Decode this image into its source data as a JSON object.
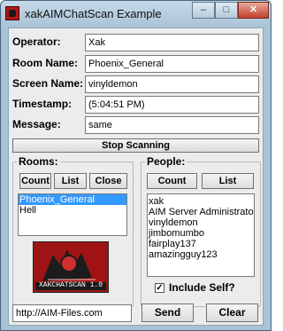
{
  "window": {
    "title": "xakAIMChatScan Example",
    "minimize": "–",
    "maximize": "□",
    "close": "✕"
  },
  "fields": {
    "operator": {
      "label": "Operator:",
      "value": "Xak"
    },
    "room_name": {
      "label": "Room Name:",
      "value": "Phoenix_General"
    },
    "screen_name": {
      "label": "Screen Name:",
      "value": "vinyldemon"
    },
    "timestamp": {
      "label": "Timestamp:",
      "value": "(5:04:51 PM)"
    },
    "message": {
      "label": "Message:",
      "value": "same"
    }
  },
  "stop_button": "Stop Scanning",
  "rooms": {
    "label": "Rooms:",
    "count_button": "Count",
    "list_button": "List",
    "close_button": "Close",
    "items": [
      "Phoenix_General",
      "Hell"
    ],
    "selected_index": 0
  },
  "people": {
    "label": "People:",
    "count_button": "Count",
    "list_button": "List",
    "items": [
      "xak",
      "AIM Server Administrator",
      "vinyldemon",
      "jimbomumbo",
      "fairplay137",
      "amazingguy123"
    ],
    "include_self_label": "Include Self?",
    "include_self_checked": true
  },
  "logo_text": "XAKCHATSCAN 1.0",
  "footer": {
    "url": "http://AIM-Files.com",
    "send_button": "Send",
    "clear_button": "Clear"
  },
  "colors": {
    "accent_selection": "#3399ff",
    "logo_red": "#9e1414"
  }
}
